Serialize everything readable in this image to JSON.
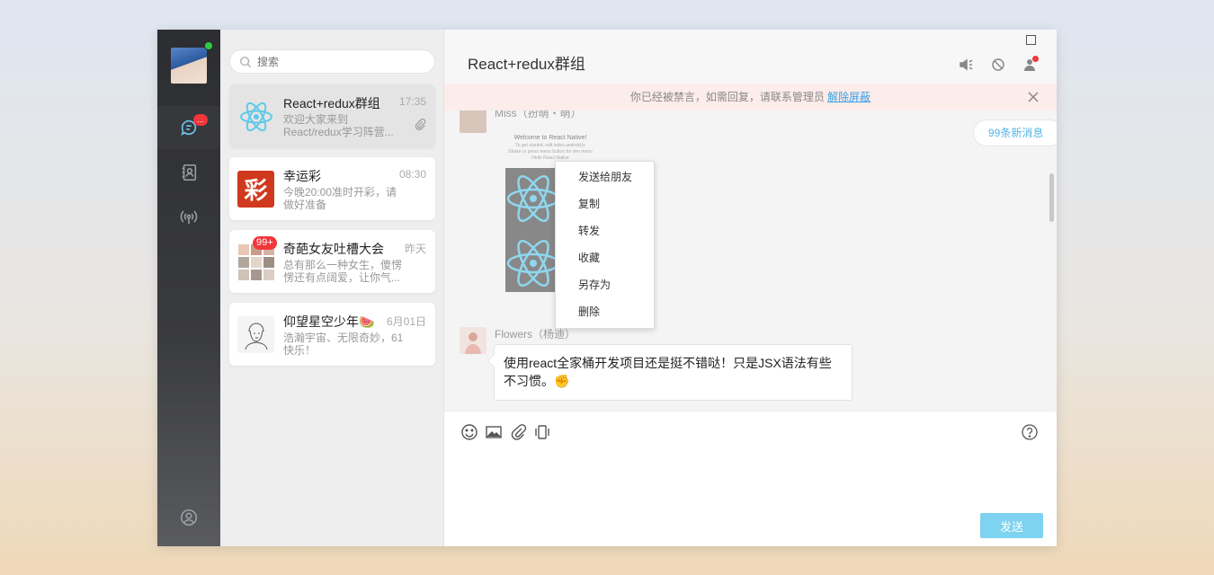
{
  "search": {
    "placeholder": "搜索"
  },
  "rail": {
    "chat_badge": "..."
  },
  "conversations": [
    {
      "name": "React+redux群组",
      "time": "17:35",
      "preview": "欢迎大家来到React/redux学习阵营..."
    },
    {
      "name": "幸运彩",
      "time": "08:30",
      "preview": "今晚20:00准时开彩，请做好准备"
    },
    {
      "name": "奇葩女友吐槽大会",
      "time": "昨天",
      "preview": "总有那么一种女生，傻愣愣还有点阔爱，让你气...",
      "badge": "99+"
    },
    {
      "name": "仰望星空少年🍉",
      "time": "6月01日",
      "preview": "浩瀚宇宙、无限奇妙，61快乐！"
    }
  ],
  "chat": {
    "title": "React+redux群组",
    "banner_text": "你已经被禁言，如需回复，请联系管理员",
    "banner_link": "解除屏蔽",
    "new_messages": "99条新消息",
    "msg1_sender": "Miss（扮萌・萌）",
    "msg2_sender": "Flowers（杨迪）",
    "msg2_text": "使用react全家桶开发项目还是挺不错哒！只是JSX语法有些不习惯。✊",
    "send_label": "发送"
  },
  "image_caption": {
    "title": "Welcome to React Native!",
    "line1": "To get started, edit index.android.js",
    "line2": "Shake or press menu button for dev menu",
    "line3": "Hello React Native"
  },
  "context_menu": [
    "发送给朋友",
    "复制",
    "转发",
    "收藏",
    "另存为",
    "删除"
  ]
}
